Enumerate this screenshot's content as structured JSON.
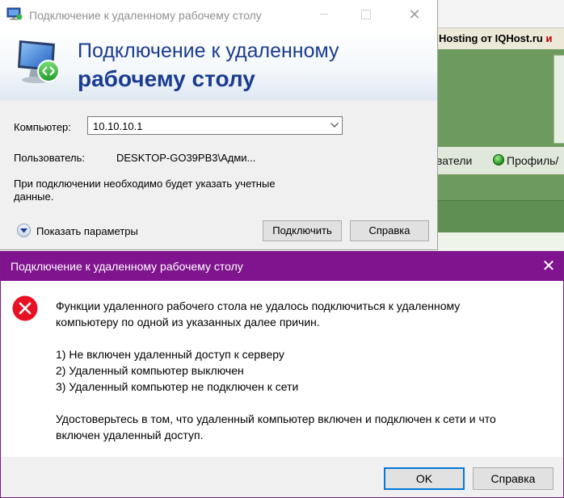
{
  "background": {
    "hosting_text": "Hosting от IQHost.ru",
    "hosting_suffix": "и",
    "nav_users": "ватели",
    "nav_profile": "Профиль/"
  },
  "rdp_window": {
    "title": "Подключение к удаленному рабочему столу",
    "banner_line1": "Подключение к удаленному",
    "banner_line2": "рабочему столу",
    "computer_label": "Компьютер:",
    "computer_value": "10.10.10.1",
    "user_label": "Пользователь:",
    "user_value": "DESKTOP-GO39PB3\\Адми...",
    "note_line1": "При подключении необходимо будет указать учетные",
    "note_line2": "данные.",
    "show_options": "Показать параметры",
    "connect_button": "Подключить",
    "help_button": "Справка"
  },
  "error_dialog": {
    "title": "Подключение к удаленному рабочему столу",
    "message_line1": "Функции удаленного рабочего стола не удалось подключиться к удаленному",
    "message_line2": "компьютеру по одной из указанных далее причин.",
    "reason1": "1) Не включен удаленный доступ к серверу",
    "reason2": "2) Удаленный компьютер выключен",
    "reason3": "3) Удаленный компьютер не подключен к сети",
    "advice_line1": "Удостоверьтесь в том, что удаленный компьютер включен и подключен к сети и что",
    "advice_line2": "включен удаленный доступ.",
    "ok_button": "OK",
    "help_button": "Справка"
  },
  "colors": {
    "dialog_titlebar": "#80148e",
    "banner_text": "#1b3d8f",
    "error_icon": "#e81123",
    "background_green": "#6d9b5e"
  },
  "icons": [
    "rdp-app-icon",
    "monitor-icon",
    "chevron-down-icon",
    "expand-circle-icon",
    "error-icon",
    "close-icon",
    "globe-icon"
  ]
}
